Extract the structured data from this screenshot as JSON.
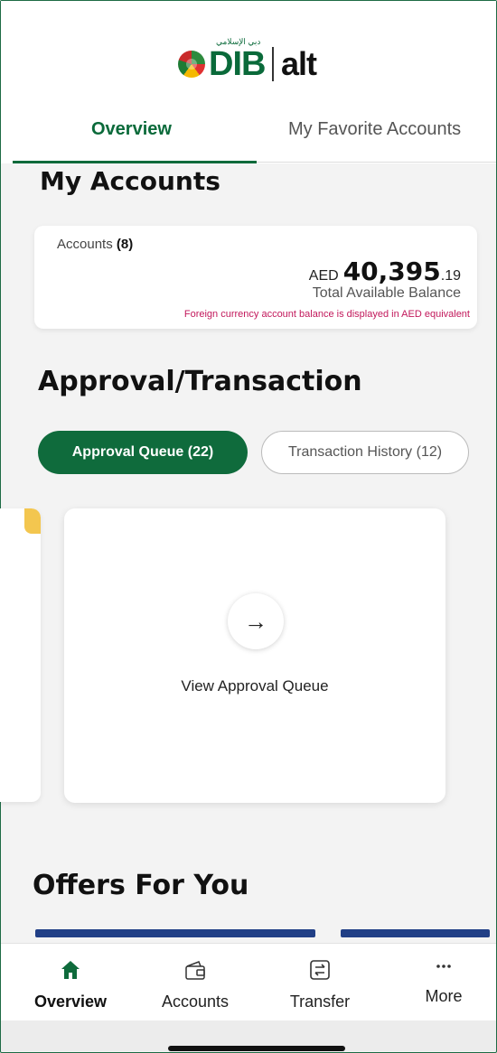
{
  "brand": {
    "logo_arabic": "دبي الإسلامي",
    "logo_dib": "DIB",
    "logo_alt": "alt"
  },
  "tabs": [
    {
      "label": "Overview",
      "active": true
    },
    {
      "label": "My Favorite Accounts",
      "active": false
    }
  ],
  "accounts": {
    "title": "My Accounts",
    "count_label": "Accounts",
    "count": "(8)",
    "currency": "AED",
    "balance_main": "40,395",
    "balance_decimals": ".19",
    "balance_label": "Total Available Balance",
    "note": "Foreign currency account balance is displayed in AED equivalent"
  },
  "approval": {
    "title": "Approval/Transaction",
    "pills": [
      {
        "label": "Approval Queue (22)",
        "active": true
      },
      {
        "label": "Transaction History (12)",
        "active": false
      }
    ],
    "card_label": "View Approval Queue",
    "arrow_glyph": "→"
  },
  "offers": {
    "title": "Offers For You"
  },
  "bottom_nav": [
    {
      "label": "Overview",
      "icon": "home-icon",
      "active": true
    },
    {
      "label": "Accounts",
      "icon": "wallet-icon",
      "active": false
    },
    {
      "label": "Transfer",
      "icon": "transfer-icon",
      "active": false
    },
    {
      "label": "More",
      "icon": "more-icon",
      "active": false
    }
  ],
  "colors": {
    "brand_green": "#0f6b3c",
    "note_red": "#c2185b",
    "offer_blue": "#213f86",
    "peek_yellow": "#f3c64f"
  }
}
